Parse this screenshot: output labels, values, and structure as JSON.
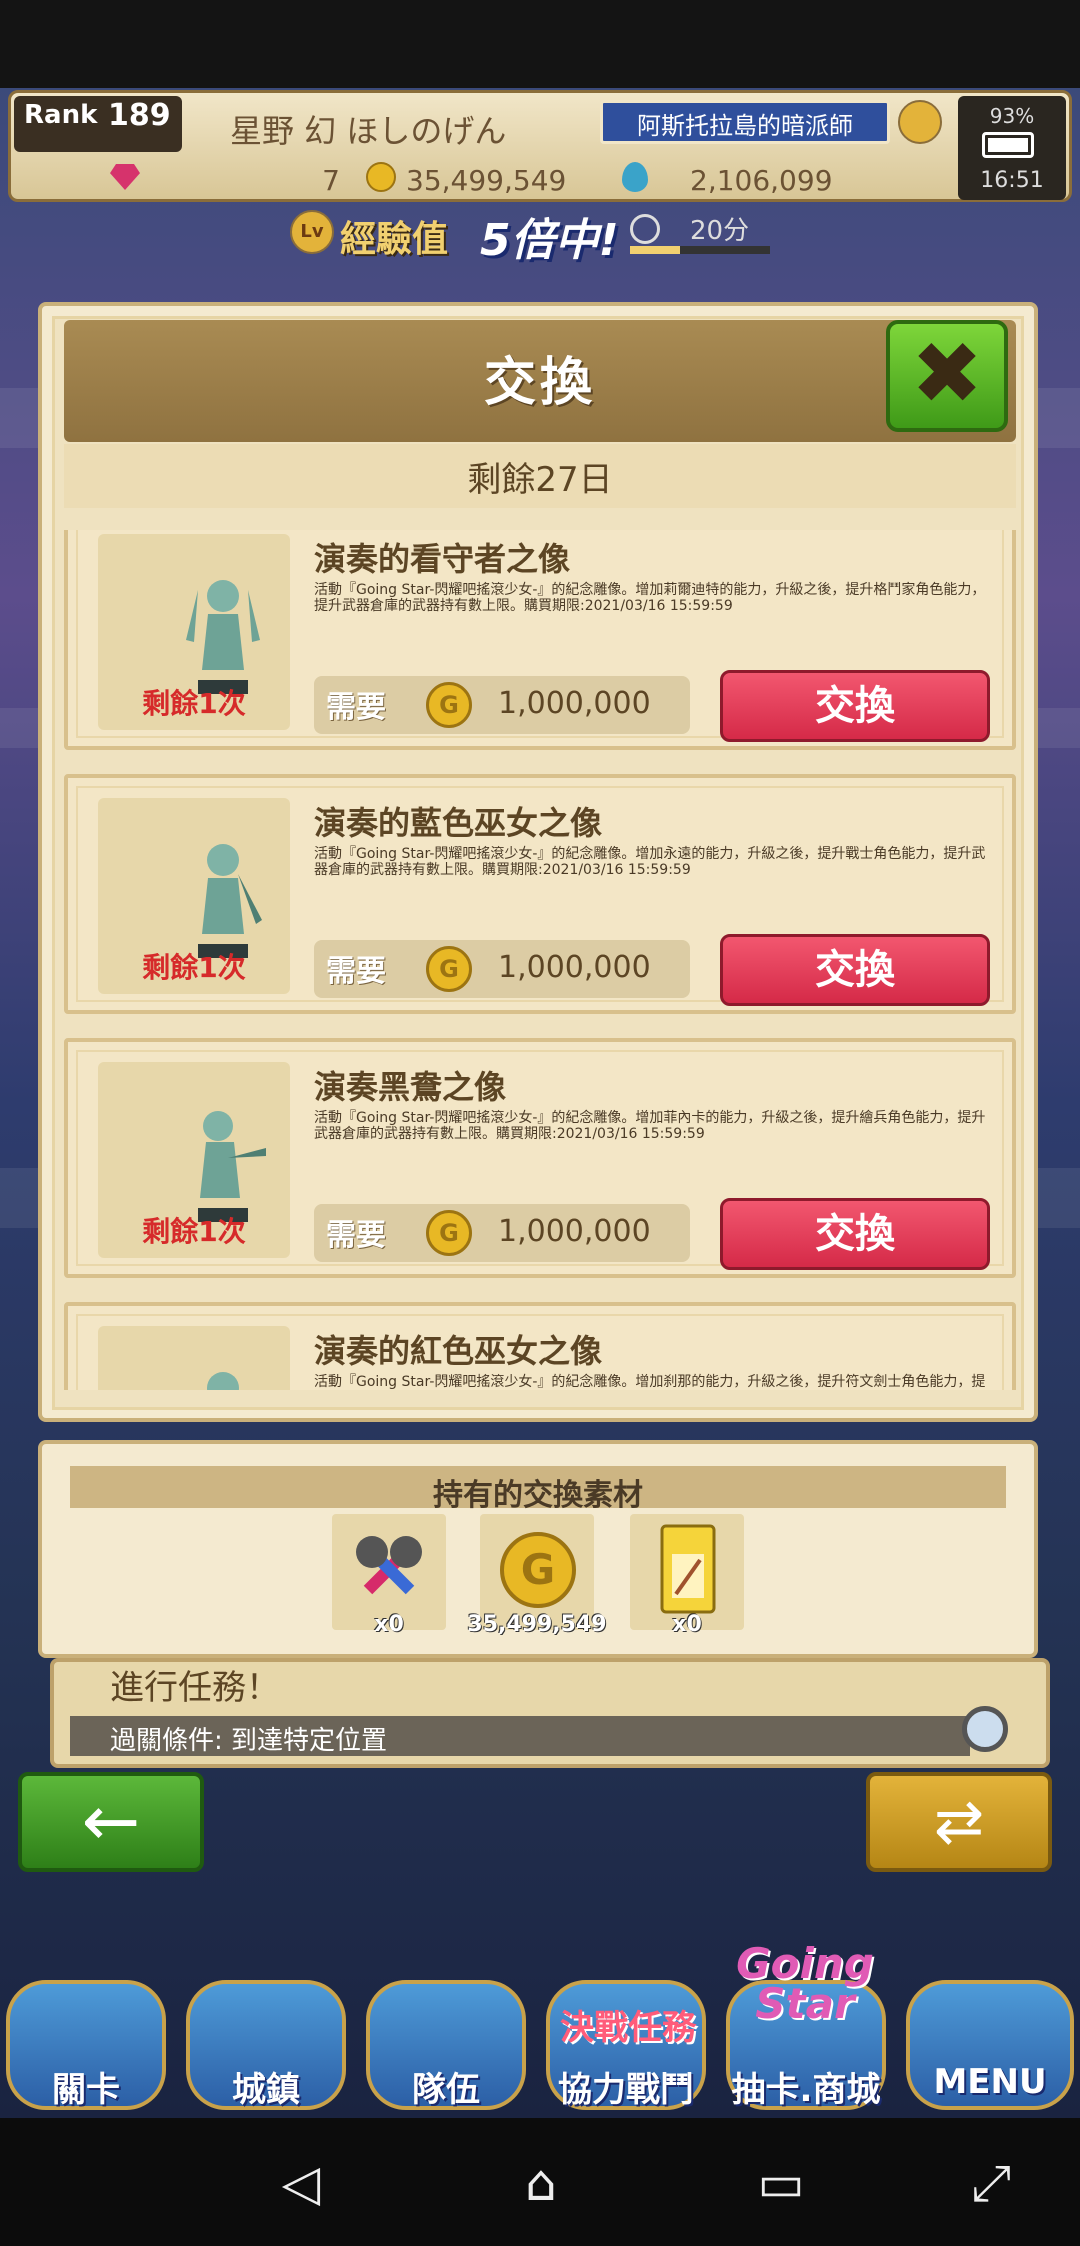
{
  "header": {
    "rank_label": "Rank",
    "rank_value": "189",
    "player_name": "星野 幻 ほしのげん",
    "player_title": "阿斯托拉島的暗派師",
    "gems": "7",
    "gold": "35,499,549",
    "drops": "2,106,099",
    "battery": "93%",
    "time": "16:51"
  },
  "exp_banner": {
    "lv": "Lv",
    "text": "經驗值",
    "multiplier": "5倍中!",
    "time_left": "20分"
  },
  "modal": {
    "title": "交換",
    "remaining": "剩餘27日",
    "close_label": "✖"
  },
  "items": [
    {
      "name": "演奏的看守者之像",
      "desc": "活動『Going Star-閃耀吧搖滾少女-』的紀念雕像。增加莉爾迪特的能力，升級之後，提升格鬥家角色能力，提升武器倉庫的武器持有數上限。購買期限:2021/03/16 15:59:59",
      "remain": "剩餘1次",
      "cost_label": "需要",
      "cost_icon": "G",
      "cost": "1,000,000",
      "button": "交換"
    },
    {
      "name": "演奏的藍色巫女之像",
      "desc": "活動『Going Star-閃耀吧搖滾少女-』的紀念雕像。增加永遠的能力，升級之後，提升戰士角色能力，提升武器倉庫的武器持有數上限。購買期限:2021/03/16 15:59:59",
      "remain": "剩餘1次",
      "cost_label": "需要",
      "cost_icon": "G",
      "cost": "1,000,000",
      "button": "交換"
    },
    {
      "name": "演奏黑鴦之像",
      "desc": "活動『Going Star-閃耀吧搖滾少女-』的紀念雕像。增加菲內卡的能力，升級之後，提升繪兵角色能力，提升武器倉庫的武器持有數上限。購買期限:2021/03/16 15:59:59",
      "remain": "剩餘1次",
      "cost_label": "需要",
      "cost_icon": "G",
      "cost": "1,000,000",
      "button": "交換"
    },
    {
      "name": "演奏的紅色巫女之像",
      "desc": "活動『Going Star-閃耀吧搖滾少女-』的紀念雕像。增加刹那的能力，升級之後，提升符文劍士角色能力，提升武器",
      "remain": "",
      "cost_label": "",
      "cost_icon": "",
      "cost": "",
      "button": ""
    }
  ],
  "materials": {
    "title": "持有的交換素材",
    "slots": [
      {
        "icon": "microphones-icon",
        "count": "x0"
      },
      {
        "icon": "gold-coin-icon",
        "count": "35,499,549",
        "glyph": "G"
      },
      {
        "icon": "ticket-icon",
        "count": "x0"
      }
    ]
  },
  "quest": {
    "title": "進行任務！",
    "condition": "過關條件: 到達特定位置"
  },
  "nav": {
    "back": "←",
    "refresh": "⇄",
    "event_badge": "決戰任務",
    "going_star": "Going Star",
    "items": [
      "關卡",
      "城鎮",
      "隊伍",
      "協力戰鬥",
      "抽卡.商城",
      "MENU"
    ]
  },
  "system_nav": {
    "back": "◁",
    "home": "⌂",
    "recents": "▭",
    "rotate": "⤢"
  },
  "colors": {
    "exchange_button": "#e23a56",
    "close_button": "#5cb83a",
    "panel": "#f4ead0",
    "remain_text": "#d62a2a"
  }
}
